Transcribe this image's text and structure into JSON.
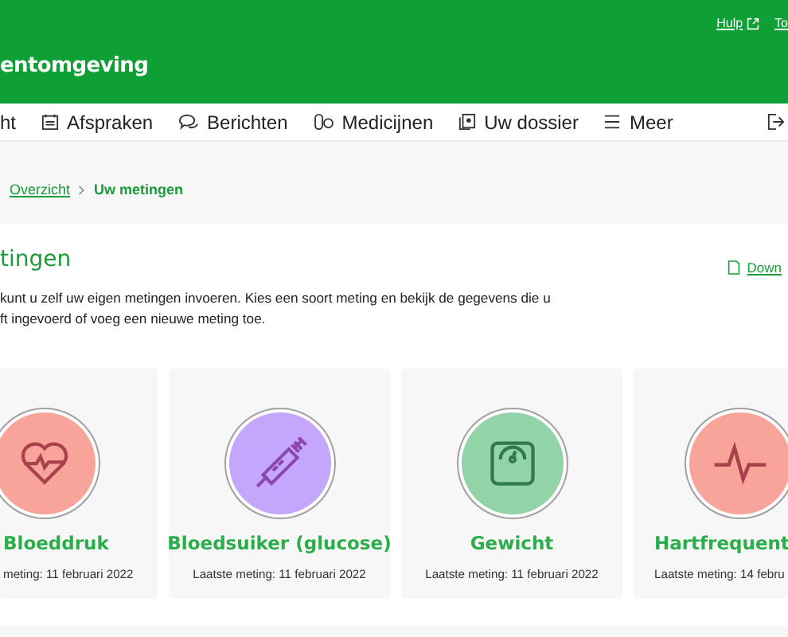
{
  "header": {
    "links": [
      {
        "label": "Hulp",
        "external": true
      },
      {
        "label": "To",
        "external": false
      }
    ],
    "title": "entomgeving"
  },
  "nav": {
    "items": [
      {
        "label": "ht",
        "kind": "none",
        "selected": false
      },
      {
        "label": "Afspraken",
        "kind": "calendar",
        "selected": false
      },
      {
        "label": "Berichten",
        "kind": "chat",
        "selected": false
      },
      {
        "label": "Medicijnen",
        "kind": "pills",
        "selected": false
      },
      {
        "label": "Uw dossier",
        "kind": "document",
        "selected": false
      },
      {
        "label": "Meer",
        "kind": "menu",
        "selected": false
      }
    ]
  },
  "breadcrumb": [
    {
      "label": "Overzicht",
      "current": false
    },
    {
      "label": "Uw metingen",
      "current": true
    }
  ],
  "section": {
    "heading": "tingen",
    "download": "Down",
    "lines": [
      "kunt u zelf uw eigen metingen invoeren. Kies een soort meting en bekijk de gegevens die u",
      "ft ingevoerd of voeg een nieuwe meting toe."
    ]
  },
  "cards": [
    {
      "title": "Bloeddruk",
      "last": "meting: 11 februari 2022",
      "kind": "heart",
      "color": "#f8a49a"
    },
    {
      "title": "Bloedsuiker (glucose)",
      "last": "Laatste meting: 11 februari 2022",
      "kind": "syringe",
      "color": "#c4a6fc"
    },
    {
      "title": "Gewicht",
      "last": "Laatste meting: 11 februari 2022",
      "kind": "scale",
      "color": "#92d3a8"
    },
    {
      "title": "Hartfrequent",
      "last": "Laatste meting: 14 febru",
      "kind": "pulse",
      "color": "#f8a49a"
    }
  ]
}
